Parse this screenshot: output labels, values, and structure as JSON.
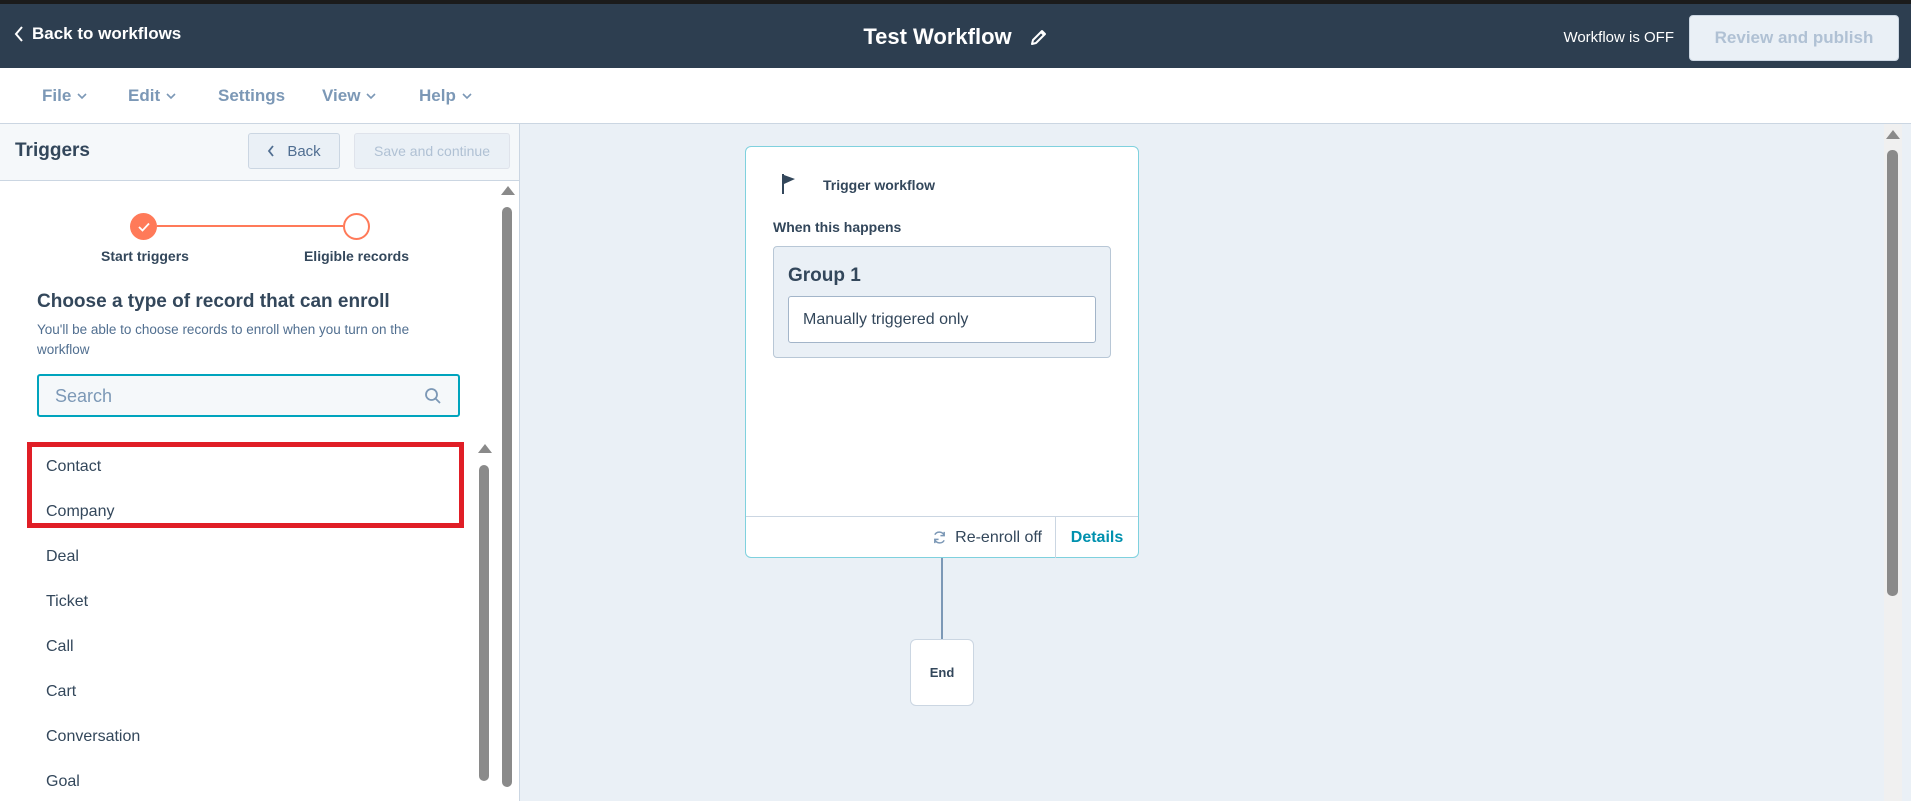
{
  "header": {
    "back_label": "Back to workflows",
    "title": "Test Workflow",
    "status": "Workflow is OFF",
    "publish_label": "Review and publish"
  },
  "menu": {
    "items": [
      {
        "label": "File",
        "has_dropdown": true
      },
      {
        "label": "Edit",
        "has_dropdown": true
      },
      {
        "label": "Settings",
        "has_dropdown": false
      },
      {
        "label": "View",
        "has_dropdown": true
      },
      {
        "label": "Help",
        "has_dropdown": true
      }
    ]
  },
  "panel": {
    "title": "Triggers",
    "back_label": "Back",
    "save_label": "Save and continue",
    "steps": [
      {
        "label": "Start triggers",
        "state": "complete"
      },
      {
        "label": "Eligible records",
        "state": "current"
      }
    ],
    "choose_title": "Choose a type of record that can enroll",
    "choose_subtitle": "You'll be able to choose records to enroll when you turn on the workflow",
    "search": {
      "placeholder": "Search",
      "value": ""
    },
    "records": [
      "Contact",
      "Company",
      "Deal",
      "Ticket",
      "Call",
      "Cart",
      "Conversation",
      "Goal"
    ]
  },
  "canvas": {
    "trigger": {
      "title": "Trigger workflow",
      "when_label": "When this happens",
      "group_title": "Group 1",
      "group_filter": "Manually triggered only",
      "reenroll_label": "Re-enroll off",
      "details_label": "Details"
    },
    "end_label": "End"
  },
  "colors": {
    "header_bg": "#2d3e50",
    "accent_orange": "#ff7a59",
    "accent_teal": "#00a4bd",
    "highlight_red": "#e01e26",
    "canvas_bg": "#eaf0f6"
  },
  "icons": [
    "chevron-left-icon",
    "pencil-icon",
    "chevron-down-icon",
    "check-icon",
    "search-icon",
    "flag-icon",
    "refresh-icon"
  ]
}
